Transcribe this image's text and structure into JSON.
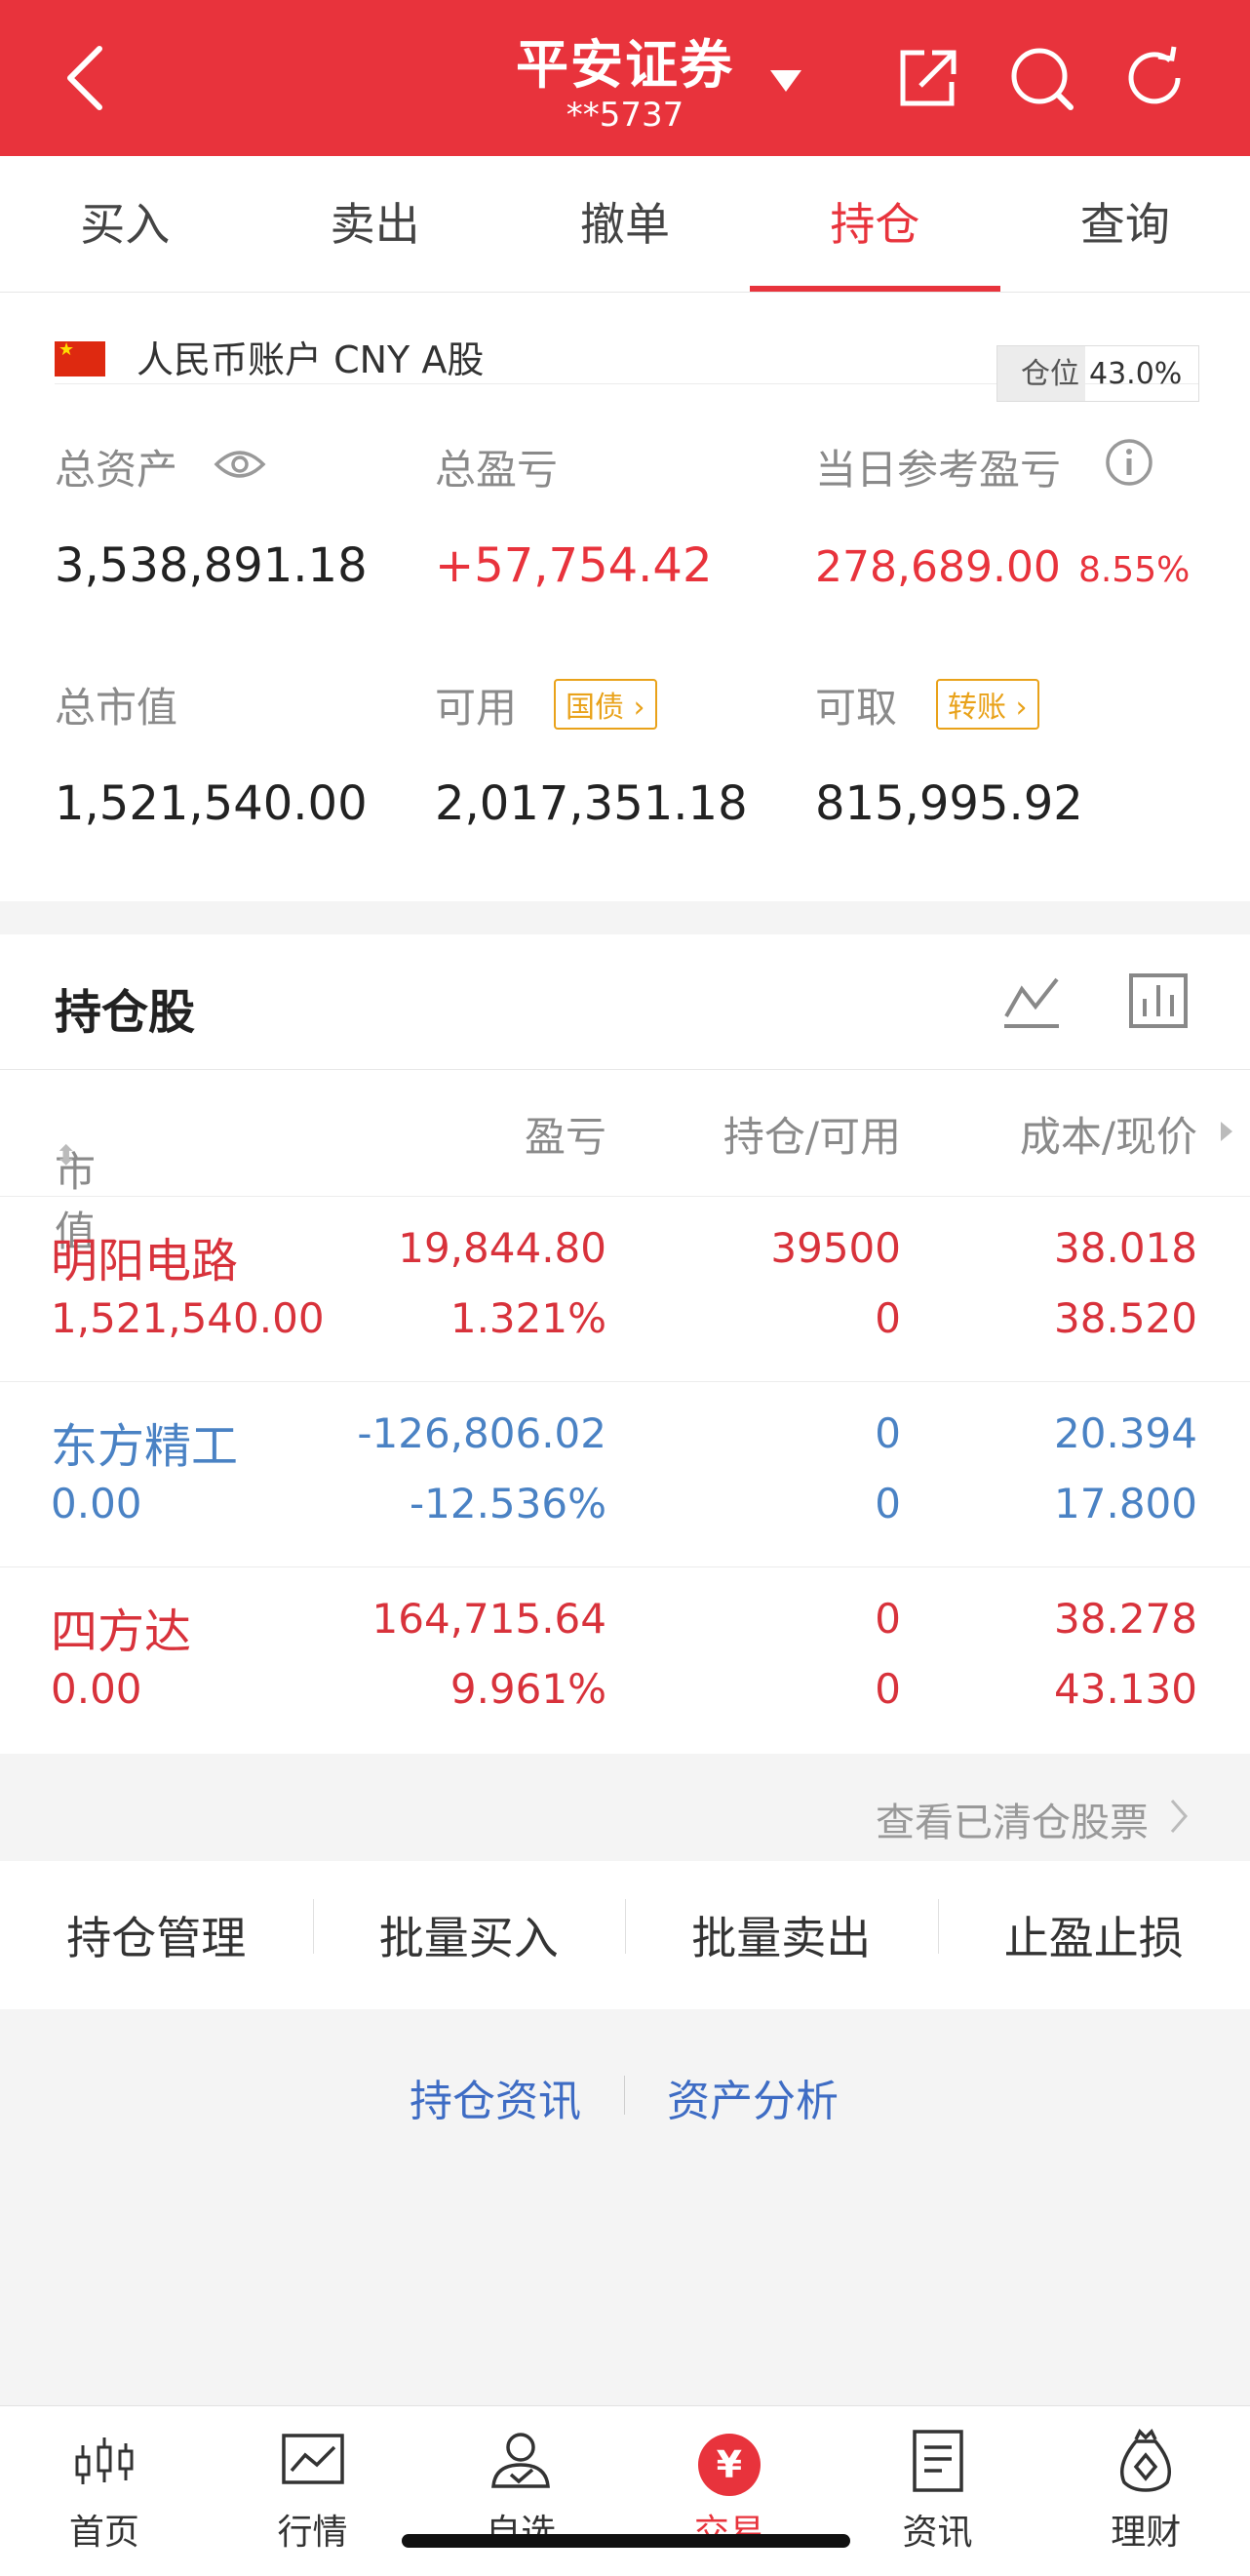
{
  "header": {
    "title": "平安证券",
    "account": "**5737",
    "icons": [
      "back-icon",
      "dropdown-caret-icon",
      "share-icon",
      "search-icon",
      "refresh-icon"
    ]
  },
  "tabs": [
    {
      "label": "买入"
    },
    {
      "label": "卖出"
    },
    {
      "label": "撤单"
    },
    {
      "label": "持仓",
      "active": true
    },
    {
      "label": "查询"
    }
  ],
  "account": {
    "name": "人民币账户 CNY A股",
    "position_label": "仓位",
    "position_value": "43.0%"
  },
  "summary": {
    "total_assets_label": "总资产",
    "total_assets": "3,538,891.18",
    "total_pl_label": "总盈亏",
    "total_pl": "+57,754.42",
    "daily_pl_label": "当日参考盈亏",
    "daily_pl": "278,689.00",
    "daily_pl_pct": "8.55%",
    "market_value_label": "总市值",
    "market_value": "1,521,540.00",
    "available_label": "可用",
    "available_tag": "国债",
    "available": "2,017,351.18",
    "withdrawable_label": "可取",
    "withdrawable_tag": "转账",
    "withdrawable": "815,995.92"
  },
  "holdings": {
    "title": "持仓股",
    "columns": {
      "market_value": "市值",
      "pl": "盈亏",
      "position": "持仓/可用",
      "cost": "成本/现价"
    },
    "rows": [
      {
        "name": "明阳电路",
        "market_value": "1,521,540.00",
        "pl": "19,844.80",
        "pl_pct": "1.321%",
        "position": "39500",
        "available": "0",
        "cost": "38.018",
        "price": "38.520",
        "color": "#d8323b"
      },
      {
        "name": "东方精工",
        "market_value": "0.00",
        "pl": "-126,806.02",
        "pl_pct": "-12.536%",
        "position": "0",
        "available": "0",
        "cost": "20.394",
        "price": "17.800",
        "color": "#4a82c4"
      },
      {
        "name": "四方达",
        "market_value": "0.00",
        "pl": "164,715.64",
        "pl_pct": "9.961%",
        "position": "0",
        "available": "0",
        "cost": "38.278",
        "price": "43.130",
        "color": "#d8323b"
      }
    ],
    "cleared_link": "查看已清仓股票"
  },
  "actions": [
    "持仓管理",
    "批量买入",
    "批量卖出",
    "止盈止损"
  ],
  "links": [
    "持仓资讯",
    "资产分析"
  ],
  "bottom_nav": [
    {
      "label": "首页",
      "icon": "candlestick-icon"
    },
    {
      "label": "行情",
      "icon": "chart-icon"
    },
    {
      "label": "自选",
      "icon": "user-check-icon"
    },
    {
      "label": "交易",
      "icon": "yuan-icon",
      "active": true,
      "glyph": "¥"
    },
    {
      "label": "资讯",
      "icon": "document-icon"
    },
    {
      "label": "理财",
      "icon": "money-bag-icon"
    }
  ],
  "colors": {
    "brand_red": "#e8333c",
    "loss_blue": "#4a82c4",
    "tag_orange": "#e9a21a",
    "link_blue": "#3e6cc4"
  }
}
